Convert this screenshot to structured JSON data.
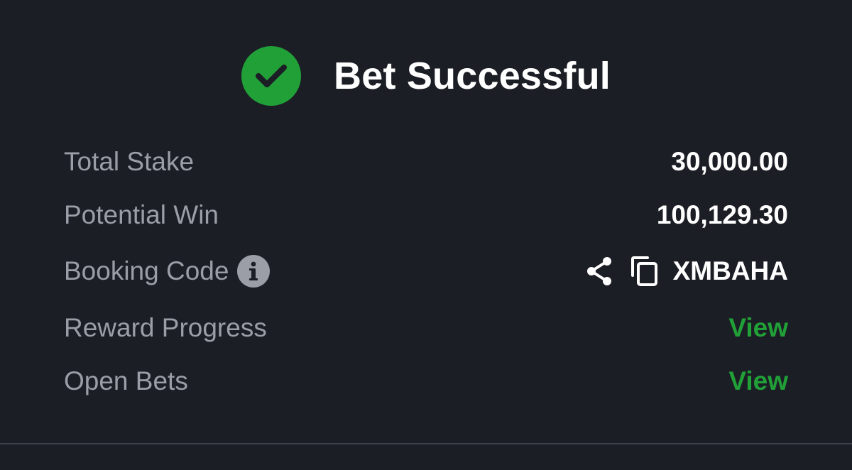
{
  "header": {
    "title": "Bet Successful",
    "icon": "check-circle-icon",
    "accent_color": "#21a038"
  },
  "rows": {
    "total_stake": {
      "label": "Total Stake",
      "value": "30,000.00"
    },
    "potential_win": {
      "label": "Potential Win",
      "value": "100,129.30"
    },
    "booking_code": {
      "label": "Booking Code",
      "value": "XMBAHA",
      "icons": [
        "info-icon",
        "share-icon",
        "copy-icon"
      ]
    },
    "reward_progress": {
      "label": "Reward Progress",
      "link": "View"
    },
    "open_bets": {
      "label": "Open Bets",
      "link": "View"
    }
  },
  "colors": {
    "background": "#1c1e25",
    "label": "#9b9ea7",
    "link": "#21a038"
  }
}
